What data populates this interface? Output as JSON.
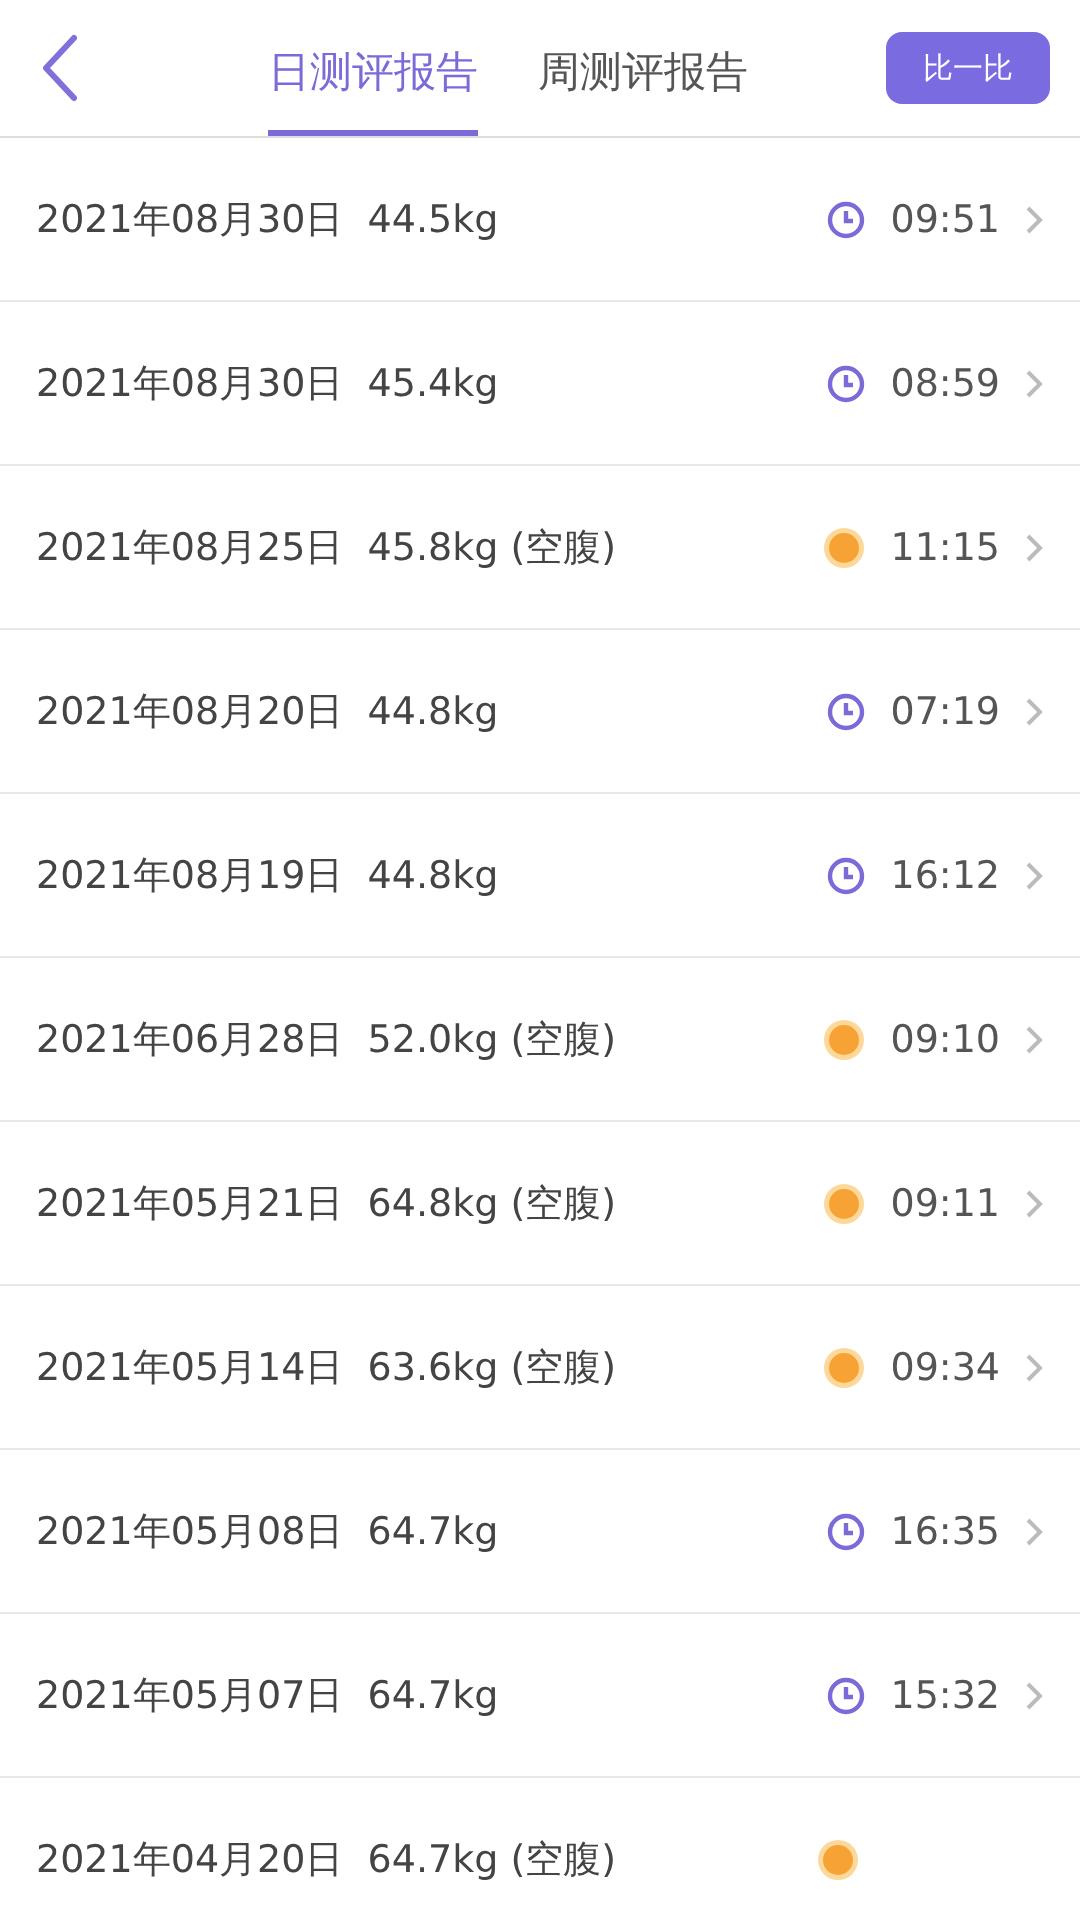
{
  "header": {
    "tabs": [
      {
        "label": "日测评报告",
        "selected": true
      },
      {
        "label": "周测评报告",
        "selected": false
      }
    ],
    "compare_button": "比一比"
  },
  "records": [
    {
      "date": "2021年08月30日",
      "weight": "44.5kg",
      "kind": "clock",
      "time": "09:51"
    },
    {
      "date": "2021年08月30日",
      "weight": "45.4kg",
      "kind": "clock",
      "time": "08:59"
    },
    {
      "date": "2021年08月25日",
      "weight": "45.8kg (空腹)",
      "kind": "sun",
      "time": "11:15"
    },
    {
      "date": "2021年08月20日",
      "weight": "44.8kg",
      "kind": "clock",
      "time": "07:19"
    },
    {
      "date": "2021年08月19日",
      "weight": "44.8kg",
      "kind": "clock",
      "time": "16:12"
    },
    {
      "date": "2021年06月28日",
      "weight": "52.0kg (空腹)",
      "kind": "sun",
      "time": "09:10"
    },
    {
      "date": "2021年05月21日",
      "weight": "64.8kg (空腹)",
      "kind": "sun",
      "time": "09:11"
    },
    {
      "date": "2021年05月14日",
      "weight": "63.6kg (空腹)",
      "kind": "sun",
      "time": "09:34"
    },
    {
      "date": "2021年05月08日",
      "weight": "64.7kg",
      "kind": "clock",
      "time": "16:35"
    },
    {
      "date": "2021年05月07日",
      "weight": "64.7kg",
      "kind": "clock",
      "time": "15:32"
    },
    {
      "date": "2021年04月20日",
      "weight": "64.7kg (空腹)",
      "kind": "sun"
    }
  ]
}
